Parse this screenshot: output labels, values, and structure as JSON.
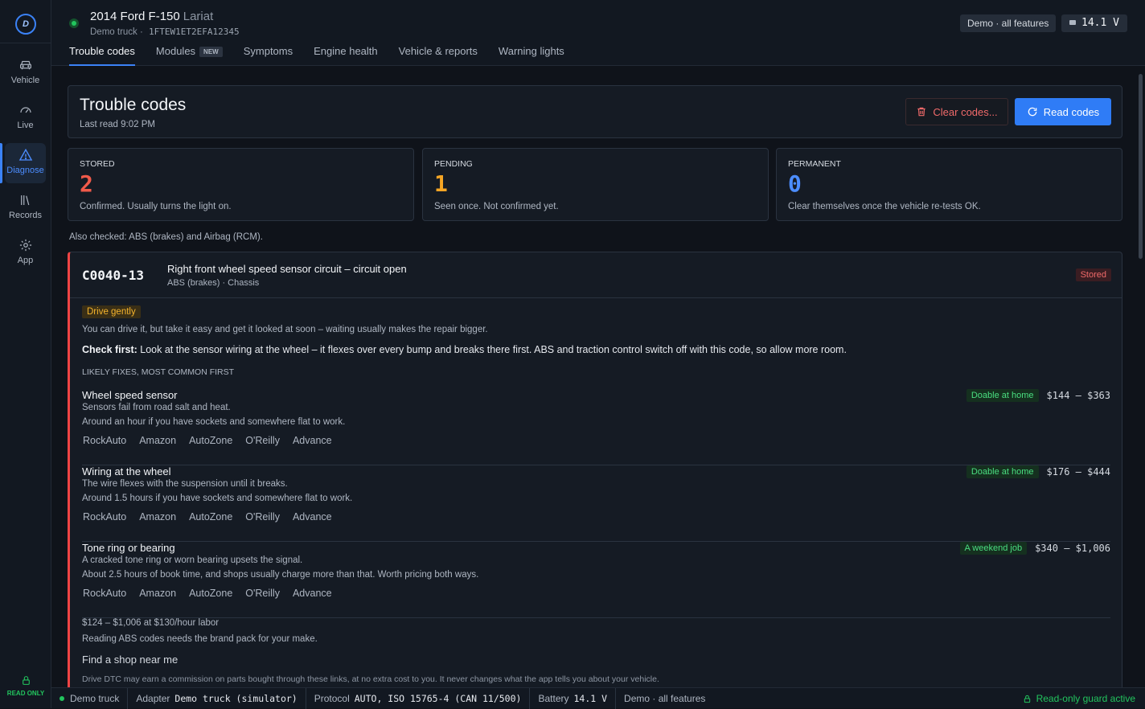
{
  "sidebar": {
    "items": [
      {
        "label": "Vehicle",
        "icon": "car-icon"
      },
      {
        "label": "Live",
        "icon": "gauge-icon"
      },
      {
        "label": "Diagnose",
        "icon": "warning-icon"
      },
      {
        "label": "Records",
        "icon": "books-icon"
      },
      {
        "label": "App",
        "icon": "gear-icon"
      }
    ],
    "readonly_label": "READ ONLY"
  },
  "header": {
    "vehicle_name": "2014 Ford F-150",
    "vehicle_trim": "Lariat",
    "vehicle_nickname": "Demo truck",
    "vin": "1FTEW1ET2EFA12345",
    "demo_badge": "Demo · all features",
    "voltage": "14.1 V",
    "tabs": [
      {
        "label": "Trouble codes"
      },
      {
        "label": "Modules",
        "badge": "NEW"
      },
      {
        "label": "Symptoms"
      },
      {
        "label": "Engine health"
      },
      {
        "label": "Vehicle & reports"
      },
      {
        "label": "Warning lights"
      }
    ]
  },
  "page": {
    "title": "Trouble codes",
    "last_read": "Last read 9:02 PM",
    "clear_button": "Clear codes...",
    "read_button": "Read codes",
    "also_checked": "Also checked: ABS (brakes) and Airbag (RCM)."
  },
  "stats": [
    {
      "label": "STORED",
      "value": "2",
      "desc": "Confirmed. Usually turns the light on.",
      "color": "#f05a4a"
    },
    {
      "label": "PENDING",
      "value": "1",
      "desc": "Seen once. Not confirmed yet.",
      "color": "#f5a524"
    },
    {
      "label": "PERMANENT",
      "value": "0",
      "desc": "Clear themselves once the vehicle re-tests OK.",
      "color": "#4c8dff"
    }
  ],
  "dtc": {
    "code": "C0040-13",
    "description": "Right front wheel speed sensor circuit – circuit open",
    "system": "ABS (brakes) · Chassis",
    "status": "Stored",
    "drive_badge": "Drive gently",
    "drive_note": "You can drive it, but take it easy and get it looked at soon – waiting usually makes the repair bigger.",
    "check_first_label": "Check first:",
    "check_first_text": "Look at the sensor wiring at the wheel – it flexes over every bump and breaks there first. ABS and traction control switch off with this code, so allow more room.",
    "fixes_heading": "LIKELY FIXES, MOST COMMON FIRST",
    "fixes": [
      {
        "name": "Wheel speed sensor",
        "line1": "Sensors fail from road salt and heat.",
        "line2": "Around an hour if you have sockets and somewhere flat to work.",
        "difficulty": "Doable at home",
        "price": "$144 – $363",
        "links": [
          "RockAuto",
          "Amazon",
          "AutoZone",
          "O'Reilly",
          "Advance"
        ]
      },
      {
        "name": "Wiring at the wheel",
        "line1": "The wire flexes with the suspension until it breaks.",
        "line2": "Around 1.5 hours if you have sockets and somewhere flat to work.",
        "difficulty": "Doable at home",
        "price": "$176 – $444",
        "links": [
          "RockAuto",
          "Amazon",
          "AutoZone",
          "O'Reilly",
          "Advance"
        ]
      },
      {
        "name": "Tone ring or bearing",
        "line1": "A cracked tone ring or worn bearing upsets the signal.",
        "line2": "About 2.5 hours of book time, and shops usually charge more than that. Worth pricing both ways.",
        "difficulty": "A weekend job",
        "price": "$340 – $1,006",
        "links": [
          "RockAuto",
          "Amazon",
          "AutoZone",
          "O'Reilly",
          "Advance"
        ]
      }
    ],
    "labor_note": "$124 – $1,006 at $130/hour labor",
    "brand_pack_note": "Reading ABS codes needs the brand pack for your make.",
    "find_shop": "Find a shop near me",
    "disclaimer": "Drive DTC may earn a commission on parts bought through these links, at no extra cost to you. It never changes what the app tells you about your vehicle."
  },
  "statusbar": {
    "vehicle": "Demo truck",
    "adapter_label": "Adapter",
    "adapter_value": "Demo truck (simulator)",
    "protocol_label": "Protocol",
    "protocol_value": "AUTO, ISO 15765-4 (CAN 11/500)",
    "battery_label": "Battery",
    "battery_value": "14.1 V",
    "mode": "Demo · all features",
    "guard": "Read-only guard active"
  }
}
